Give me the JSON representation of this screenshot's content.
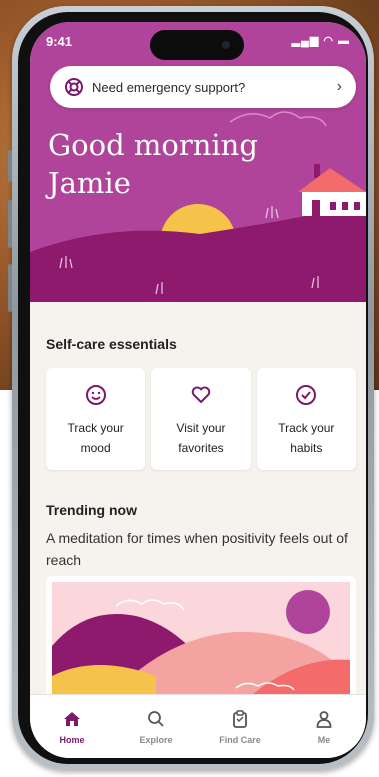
{
  "status_bar": {
    "time": "9:41",
    "icons_text": "▂▄▆ ◠ ▬"
  },
  "emergency": {
    "label": "Need emergency support?",
    "chevron": "›"
  },
  "greeting": {
    "line1": "Good morning",
    "line2": "Jamie"
  },
  "self_care": {
    "title": "Self-care essentials",
    "cards": [
      {
        "icon": "smiley-icon",
        "line1": "Track your",
        "line2": "mood"
      },
      {
        "icon": "heart-icon",
        "line1": "Visit your",
        "line2": "favorites"
      },
      {
        "icon": "check-circle-icon",
        "line1": "Track your",
        "line2": "habits"
      }
    ]
  },
  "trending": {
    "title": "Trending now",
    "description": "A meditation for times when positivity feels out of reach"
  },
  "tabs": [
    {
      "label": "Home",
      "icon": "home-icon",
      "active": true
    },
    {
      "label": "Explore",
      "icon": "search-icon",
      "active": false
    },
    {
      "label": "Find Care",
      "icon": "clipboard-icon",
      "active": false
    },
    {
      "label": "Me",
      "icon": "person-icon",
      "active": false
    }
  ],
  "colors": {
    "header": "#b0449a",
    "hill": "#8e1a6e",
    "accent": "#7a1a6a",
    "background": "#f6f2ee"
  }
}
